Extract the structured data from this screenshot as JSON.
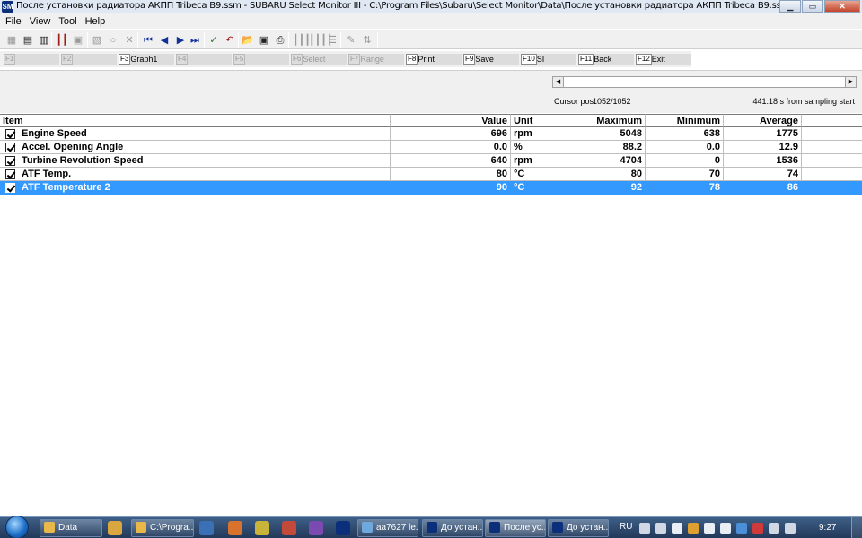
{
  "window": {
    "title": "После установки радиатора АКПП Tribeca B9.ssm - SUBARU Select Monitor III - C:\\Program Files\\Subaru\\Select Monitor\\Data\\После установки радиатора АКПП Tribeca B9.ssm",
    "icon_text": "SM",
    "minimize": "▁",
    "maximize": "▭",
    "close": "✕"
  },
  "menu": [
    "File",
    "View",
    "Tool",
    "Help"
  ],
  "toolbar": [
    {
      "name": "data-list-icon",
      "glyph": "▦",
      "tone": "gray"
    },
    {
      "name": "graph-icon",
      "glyph": "▤",
      "tone": "dark"
    },
    {
      "name": "graph-line-icon",
      "glyph": "▥",
      "tone": "dark"
    },
    {
      "name": "bars-icon",
      "glyph": "┃┃",
      "tone": "red"
    },
    {
      "name": "digital-icon",
      "glyph": "▣",
      "tone": "gray"
    },
    {
      "name": "mark-icon",
      "glyph": "▧",
      "tone": "gray"
    },
    {
      "name": "circle-icon",
      "glyph": "○",
      "tone": "gray"
    },
    {
      "name": "cross-icon",
      "glyph": "✕",
      "tone": "gray"
    },
    {
      "name": "first-icon",
      "glyph": "⏮",
      "tone": "blue"
    },
    {
      "name": "prev-icon",
      "glyph": "◀",
      "tone": "blue"
    },
    {
      "name": "next-icon",
      "glyph": "▶",
      "tone": "blue"
    },
    {
      "name": "last-icon",
      "glyph": "⏭",
      "tone": "blue"
    },
    {
      "name": "check-icon",
      "glyph": "✓",
      "tone": "green"
    },
    {
      "name": "undo-icon",
      "glyph": "↶",
      "tone": "red"
    },
    {
      "name": "open-icon",
      "glyph": "📂",
      "tone": "dark"
    },
    {
      "name": "save-icon",
      "glyph": "▣",
      "tone": "dark"
    },
    {
      "name": "print-icon",
      "glyph": "⎙",
      "tone": "dark"
    },
    {
      "name": "columns-icon",
      "glyph": "┃┃┃",
      "tone": "gray"
    },
    {
      "name": "columns-wide-icon",
      "glyph": "┃┃┃┃",
      "tone": "gray"
    },
    {
      "name": "rows-icon",
      "glyph": "☰",
      "tone": "gray"
    },
    {
      "name": "pen-icon",
      "glyph": "✎",
      "tone": "gray"
    },
    {
      "name": "sort-icon",
      "glyph": "⇅",
      "tone": "gray"
    }
  ],
  "function_keys": [
    {
      "key": "F1",
      "label": "",
      "enabled": false
    },
    {
      "key": "F2",
      "label": "",
      "enabled": false
    },
    {
      "key": "F3",
      "label": "Graph1",
      "enabled": true
    },
    {
      "key": "F4",
      "label": "",
      "enabled": false
    },
    {
      "key": "F5",
      "label": "",
      "enabled": false
    },
    {
      "key": "F6",
      "label": "Select",
      "enabled": false
    },
    {
      "key": "F7",
      "label": "Range",
      "enabled": false
    },
    {
      "key": "F8",
      "label": "Print",
      "enabled": true
    },
    {
      "key": "F9",
      "label": "Save",
      "enabled": true
    },
    {
      "key": "F10",
      "label": "SI",
      "enabled": true
    },
    {
      "key": "F11",
      "label": "Back",
      "enabled": true
    },
    {
      "key": "F12",
      "label": "Exit",
      "enabled": true
    }
  ],
  "scroll": {
    "left_arrow": "◀",
    "right_arrow": "▶"
  },
  "cursor": {
    "label": "Cursor pos",
    "value": "1052/1052"
  },
  "elapsed": "441.18 s from sampling start",
  "table": {
    "headers": {
      "item": "Item",
      "value": "Value",
      "unit": "Unit",
      "max": "Maximum",
      "min": "Minimum",
      "avg": "Average"
    },
    "rows": [
      {
        "item": "Engine Speed",
        "value": "696",
        "unit": "rpm",
        "max": "5048",
        "min": "638",
        "avg": "1775",
        "checked": true,
        "selected": false
      },
      {
        "item": "Accel. Opening Angle",
        "value": "0.0",
        "unit": "%",
        "max": "88.2",
        "min": "0.0",
        "avg": "12.9",
        "checked": true,
        "selected": false
      },
      {
        "item": "Turbine Revolution Speed",
        "value": "640",
        "unit": "rpm",
        "max": "4704",
        "min": "0",
        "avg": "1536",
        "checked": true,
        "selected": false
      },
      {
        "item": "ATF Temp.",
        "value": "80",
        "unit": "°C",
        "max": "80",
        "min": "70",
        "avg": "74",
        "checked": true,
        "selected": false
      },
      {
        "item": "ATF Temperature 2",
        "value": "90",
        "unit": "°C",
        "max": "92",
        "min": "78",
        "avg": "86",
        "checked": true,
        "selected": true
      }
    ]
  },
  "taskbar": {
    "tasks": [
      {
        "label": "Data",
        "icon_color": "#e8b84a",
        "active": false
      },
      {
        "label": "C:\\Progra...",
        "icon_color": "#e8b84a",
        "active": false
      },
      {
        "label": "aa7627 le...",
        "icon_color": "#6fa8dc",
        "active": false
      },
      {
        "label": "До устан...",
        "icon_color": "#0b2f7a",
        "active": false
      },
      {
        "label": "После ус...",
        "icon_color": "#0b2f7a",
        "active": true
      },
      {
        "label": "До устан...",
        "icon_color": "#0b2f7a",
        "active": false
      }
    ],
    "quick_icons": [
      {
        "name": "explorer-icon",
        "color": "#d9a640"
      },
      {
        "name": "media-icon",
        "color": "#3b6fb6"
      },
      {
        "name": "app-orange-icon",
        "color": "#d8722c"
      },
      {
        "name": "app-yellow-icon",
        "color": "#c8b43a"
      },
      {
        "name": "app-red-icon",
        "color": "#c24a3a"
      },
      {
        "name": "app-purple-icon",
        "color": "#7a4ab0"
      },
      {
        "name": "subaru-icon",
        "color": "#0b2f7a"
      }
    ],
    "language": "RU",
    "tray_icons": [
      {
        "name": "tray-app-icon",
        "color": "#cfd8e4"
      },
      {
        "name": "tray-device-icon",
        "color": "#cfd8e4"
      },
      {
        "name": "volume-icon",
        "color": "#e9eef5"
      },
      {
        "name": "tray-orange-icon",
        "color": "#e0a030"
      },
      {
        "name": "flag-icon",
        "color": "#e9eef5"
      },
      {
        "name": "network-icon",
        "color": "#e9eef5"
      },
      {
        "name": "tray-blue-icon",
        "color": "#4a8fd8"
      },
      {
        "name": "tray-red-icon",
        "color": "#d03a3a"
      },
      {
        "name": "shield-icon",
        "color": "#cfd8e4"
      },
      {
        "name": "tray-extra-icon",
        "color": "#cfd8e4"
      }
    ],
    "clock": "9:27"
  }
}
